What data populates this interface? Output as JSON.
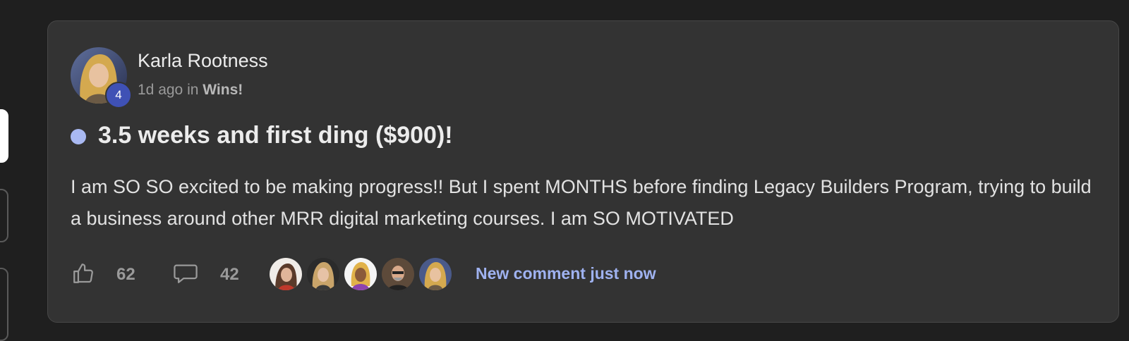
{
  "post": {
    "author": {
      "name": "Karla Rootness",
      "level": "4"
    },
    "meta": {
      "time_ago": "1d ago",
      "in_word": "in",
      "category": "Wins!"
    },
    "unread": true,
    "title": "3.5 weeks and first ding ($900)!",
    "body": "I am SO SO excited to be making progress!! But I spent MONTHS before finding Legacy Builders Program, trying to build a business around other MRR digital marketing courses. I am SO MOTIVATED",
    "likes": "62",
    "comments": "42",
    "latest_comment": "New comment just now",
    "commenter_avatars": [
      {
        "name": "commenter-avatar-1"
      },
      {
        "name": "commenter-avatar-2"
      },
      {
        "name": "commenter-avatar-3"
      },
      {
        "name": "commenter-avatar-4"
      },
      {
        "name": "commenter-avatar-5"
      }
    ]
  },
  "colors": {
    "page_background": "#1f1f1f",
    "card_background": "#333333",
    "accent_link": "#9fb2f0",
    "unread_dot": "#a9b9f2",
    "level_badge": "#3f51b5"
  },
  "icons": {
    "like": "thumbs-up-icon",
    "comment": "speech-bubble-icon"
  }
}
